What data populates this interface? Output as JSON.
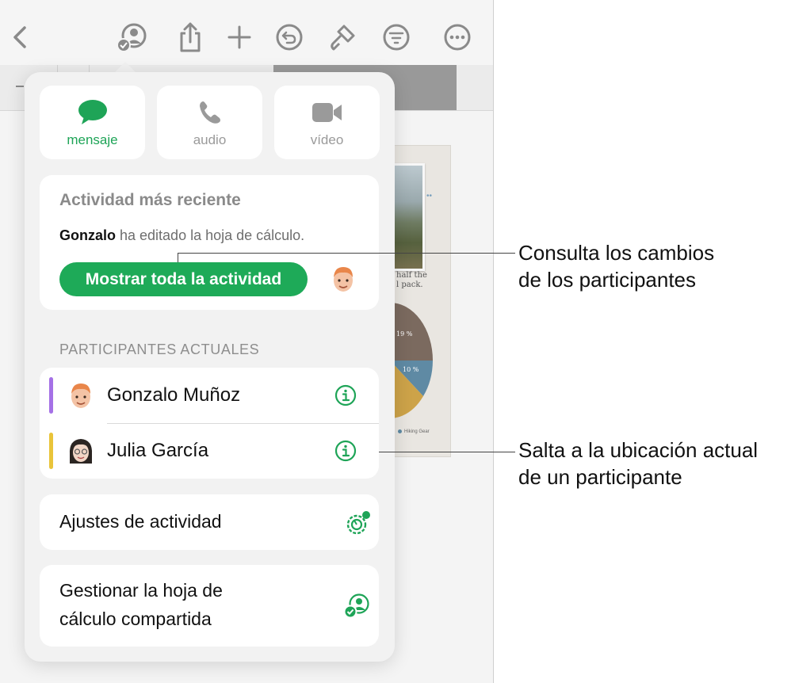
{
  "toolbar": {
    "icons": [
      "back-icon",
      "collaborate-icon",
      "share-icon",
      "add-icon",
      "undo-icon",
      "format-icon",
      "organize-icon",
      "more-icon"
    ]
  },
  "document_preview": {
    "caption_line1": "half the",
    "caption_line2": "l pack.",
    "pie_labels": [
      "19 %",
      "10 %"
    ],
    "legend_item": "Hiking Gear"
  },
  "popover": {
    "contact_buttons": {
      "message": {
        "label": "mensaje",
        "icon": "message-bubble-icon",
        "color": "#1ea457"
      },
      "audio": {
        "label": "audio",
        "icon": "phone-icon"
      },
      "video": {
        "label": "vídeo",
        "icon": "video-camera-icon"
      }
    },
    "recent_activity": {
      "title": "Actividad más reciente",
      "editor_name": "Gonzalo",
      "action_text": " ha editado la hoja de cálculo.",
      "show_all_button": "Mostrar toda la actividad",
      "accent_color": "#1eaa58"
    },
    "current_participants": {
      "header": "PARTICIPANTES ACTUALES",
      "people": [
        {
          "name": "Gonzalo Muñoz",
          "color": "#a571e6"
        },
        {
          "name": "Julia García",
          "color": "#e9c43a"
        }
      ]
    },
    "activity_settings": {
      "label": "Ajustes de actividad",
      "icon": "activity-settings-icon"
    },
    "manage_sharing": {
      "label_line1": "Gestionar la hoja de",
      "label_line2": "cálculo compartida",
      "icon": "manage-collaboration-icon"
    }
  },
  "callouts": [
    {
      "line1": "Consulta los cambios",
      "line2": "de los participantes"
    },
    {
      "line1": "Salta a la ubicación actual",
      "line2": "de un participante"
    }
  ]
}
